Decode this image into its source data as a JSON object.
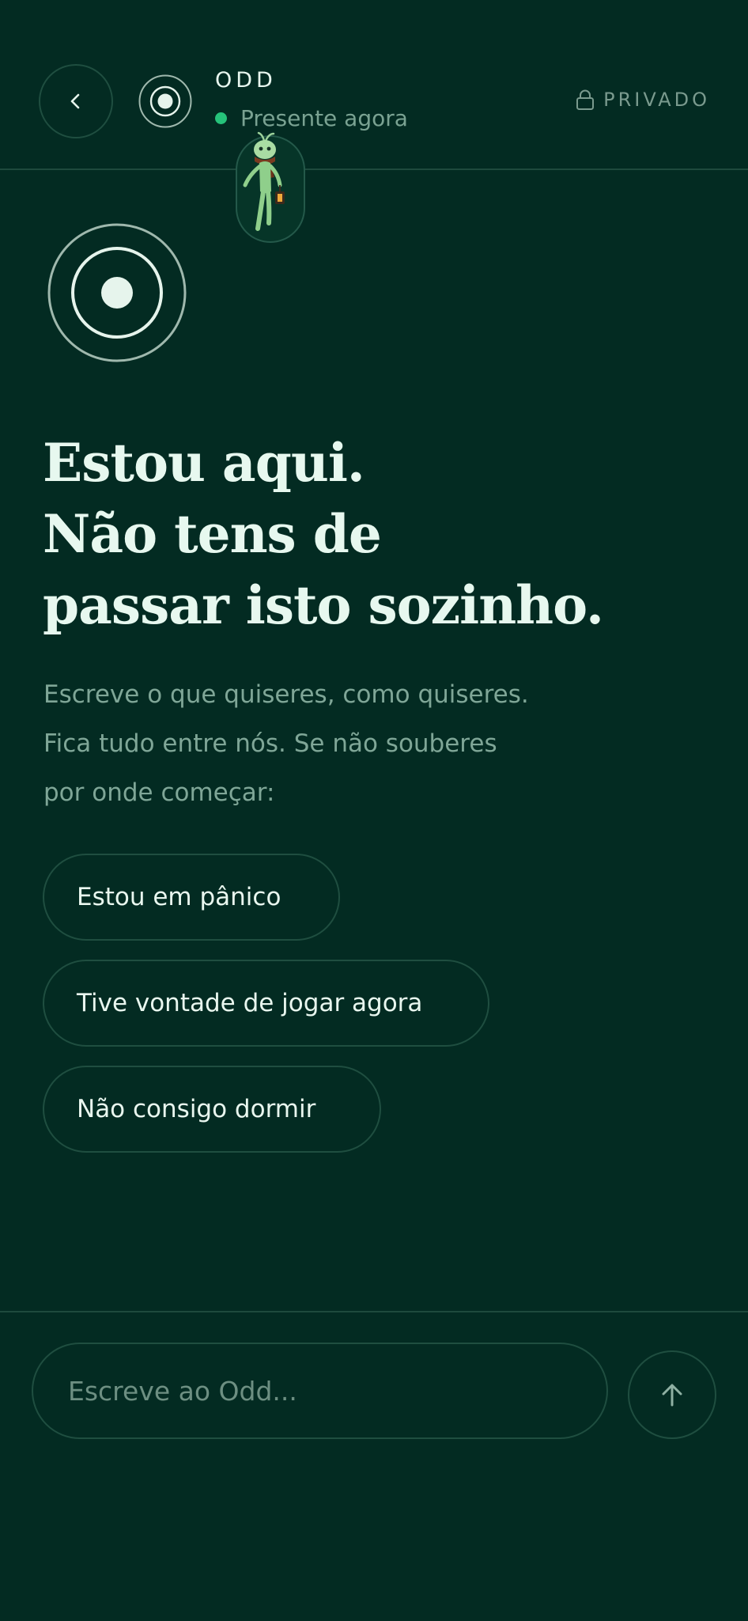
{
  "header": {
    "name": "ODD",
    "presence": "Presente agora",
    "privacy": "PRIVADO"
  },
  "main": {
    "heading": [
      "Estou aqui.",
      "Não tens de",
      "passar isto sozinho."
    ],
    "intro": [
      "Escreve o que quiseres, como quiseres.",
      "Fica tudo entre nós. Se não souberes",
      "por onde começar:"
    ],
    "suggestions": [
      "Estou em pânico",
      "Tive vontade de jogar agora",
      "Não consigo dormir"
    ]
  },
  "composer": {
    "placeholder": "Escreve ao Odd..."
  },
  "icons": {
    "back": "chevron-left-icon",
    "lock": "lock-icon",
    "send": "arrow-up-icon",
    "avatar": "target-circle-icon",
    "mascot": "sprout-character-with-lantern"
  },
  "colors": {
    "background": "#032b22",
    "border": "#1f4e40",
    "presence_dot": "#26c27a",
    "text_primary": "#e7f8ef",
    "text_muted": "#7fa697"
  }
}
